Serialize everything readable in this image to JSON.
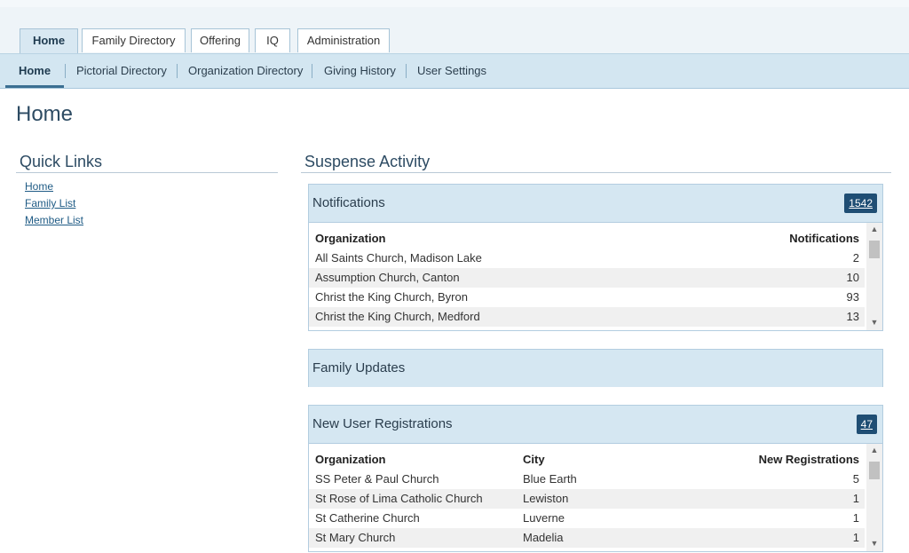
{
  "tabs": [
    {
      "label": "Home",
      "active": true
    },
    {
      "label": "Family Directory",
      "active": false
    },
    {
      "label": "Offering",
      "active": false
    },
    {
      "label": "IQ",
      "active": false
    },
    {
      "label": "Administration",
      "active": false
    }
  ],
  "subnav": [
    {
      "label": "Home",
      "active": true
    },
    {
      "label": "Pictorial Directory",
      "active": false
    },
    {
      "label": "Organization Directory",
      "active": false
    },
    {
      "label": "Giving History",
      "active": false
    },
    {
      "label": "User Settings",
      "active": false
    }
  ],
  "page": {
    "title": "Home"
  },
  "quick_links": {
    "title": "Quick Links",
    "items": [
      "Home",
      "Family List",
      "Member List"
    ]
  },
  "suspense": {
    "title": "Suspense Activity"
  },
  "notifications": {
    "title": "Notifications",
    "count": "1542",
    "columns": [
      "Organization",
      "Notifications"
    ],
    "rows": [
      {
        "org": "All Saints Church, Madison Lake",
        "value": "2"
      },
      {
        "org": "Assumption Church, Canton",
        "value": "10"
      },
      {
        "org": "Christ the King Church, Byron",
        "value": "93"
      },
      {
        "org": "Christ the King Church, Medford",
        "value": "13"
      }
    ]
  },
  "family_updates": {
    "title": "Family Updates"
  },
  "registrations": {
    "title": "New User Registrations",
    "count": "47",
    "columns": [
      "Organization",
      "City",
      "New Registrations"
    ],
    "rows": [
      {
        "org": "SS Peter & Paul Church",
        "city": "Blue Earth",
        "value": "5"
      },
      {
        "org": "St Rose of Lima Catholic Church",
        "city": "Lewiston",
        "value": "1"
      },
      {
        "org": "St Catherine Church",
        "city": "Luverne",
        "value": "1"
      },
      {
        "org": "St Mary Church",
        "city": "Madelia",
        "value": "1"
      }
    ]
  },
  "icons": {
    "scroll_up": "scroll-up-arrow-icon",
    "scroll_down": "scroll-down-arrow-icon"
  },
  "colors": {
    "accent": "#1f4e74",
    "header_bg": "#d5e7f2",
    "subnav_bg": "#d3e6f1"
  }
}
